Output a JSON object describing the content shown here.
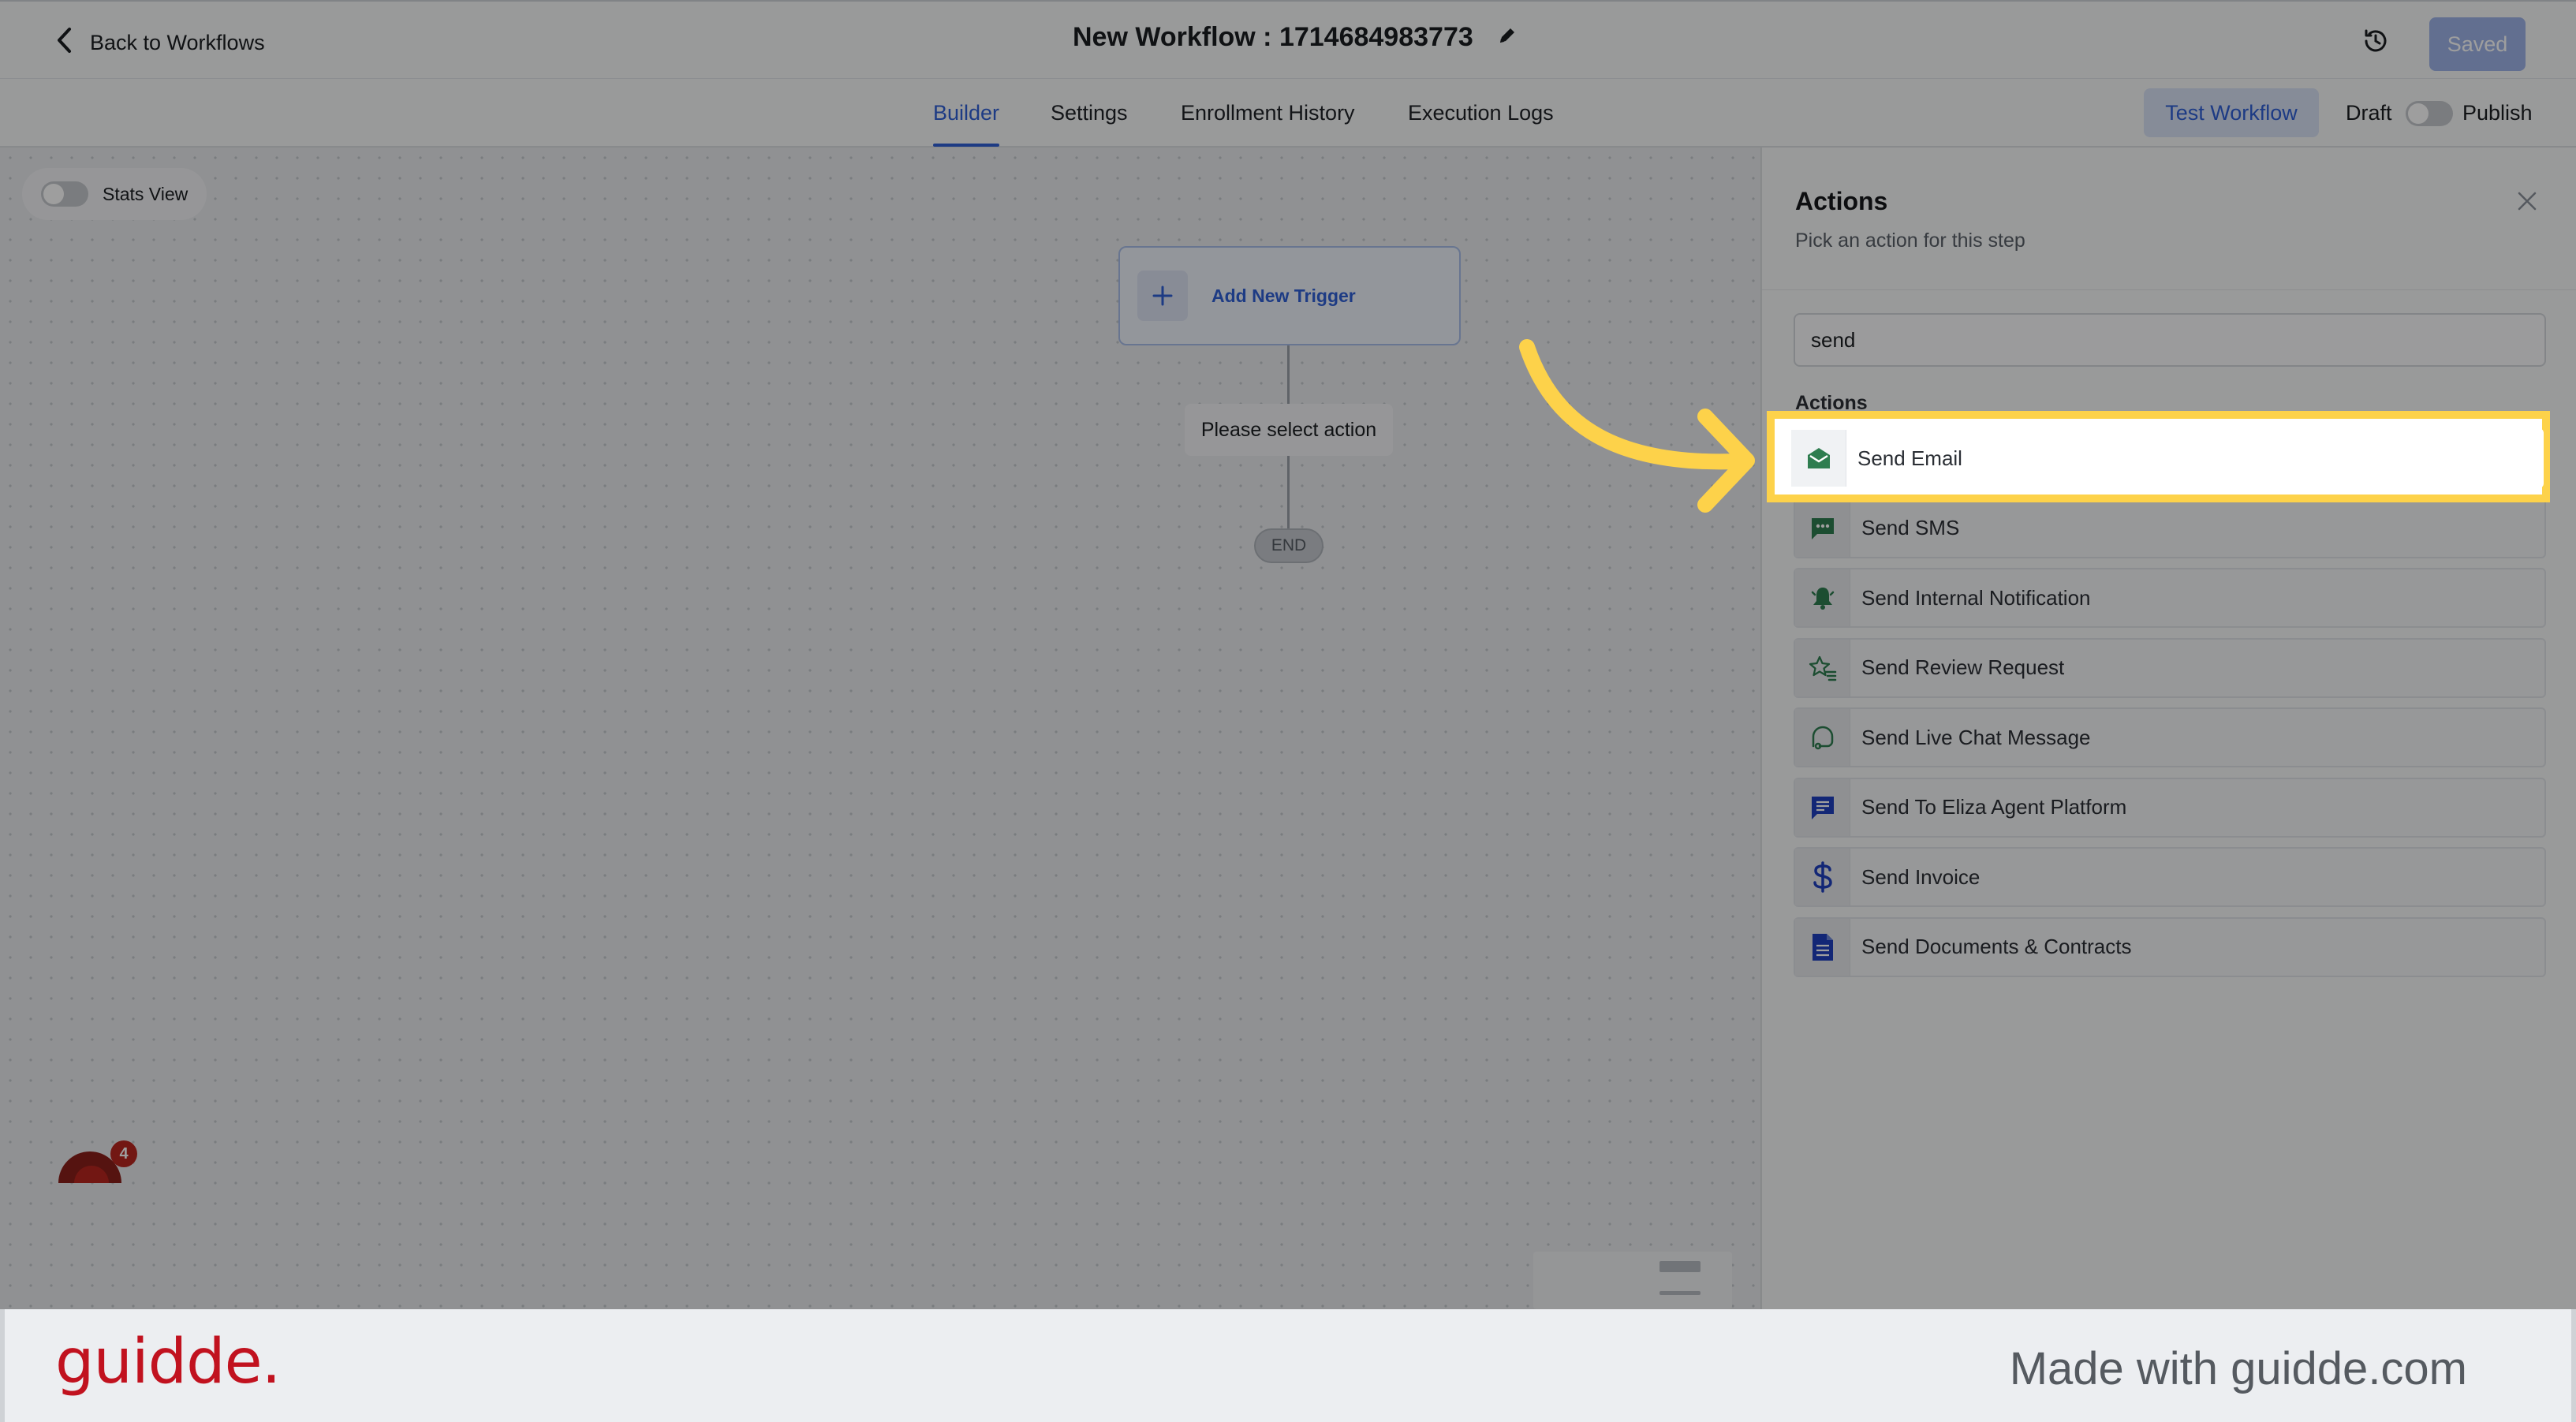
{
  "header": {
    "back_label": "Back to Workflows",
    "title": "New Workflow : 1714684983773",
    "saved_label": "Saved"
  },
  "tabs": [
    {
      "label": "Builder",
      "active": true
    },
    {
      "label": "Settings",
      "active": false
    },
    {
      "label": "Enrollment History",
      "active": false
    },
    {
      "label": "Execution Logs",
      "active": false
    }
  ],
  "toolbar": {
    "test_label": "Test Workflow",
    "draft_label": "Draft",
    "publish_label": "Publish"
  },
  "canvas": {
    "stats_label": "Stats View",
    "trigger_label": "Add New Trigger",
    "action_placeholder": "Please select action",
    "end_label": "END",
    "notification_count": "4"
  },
  "panel": {
    "title": "Actions",
    "subtitle": "Pick an action for this step",
    "search_value": "send",
    "section_label": "Actions",
    "actions": [
      {
        "label": "Send Email",
        "icon": "email-open-icon",
        "color": "#2e7d4f"
      },
      {
        "label": "Send SMS",
        "icon": "chat-bubble-icon",
        "color": "#2e7d4f"
      },
      {
        "label": "Send Internal Notification",
        "icon": "bell-icon",
        "color": "#2e7d4f"
      },
      {
        "label": "Send Review Request",
        "icon": "star-list-icon",
        "color": "#2e7d4f"
      },
      {
        "label": "Send Live Chat Message",
        "icon": "live-chat-icon",
        "color": "#2e7d4f"
      },
      {
        "label": "Send To Eliza Agent Platform",
        "icon": "message-icon",
        "color": "#1f3fbf"
      },
      {
        "label": "Send Invoice",
        "icon": "dollar-icon",
        "color": "#1f3fbf"
      },
      {
        "label": "Send Documents & Contracts",
        "icon": "document-icon",
        "color": "#1f3fbf"
      }
    ]
  },
  "footer": {
    "brand": "guidde.",
    "made_with": "Made with guidde.com"
  },
  "colors": {
    "accent": "#2f5fd6",
    "highlight": "#fdd24a",
    "brand": "#c1121f"
  }
}
